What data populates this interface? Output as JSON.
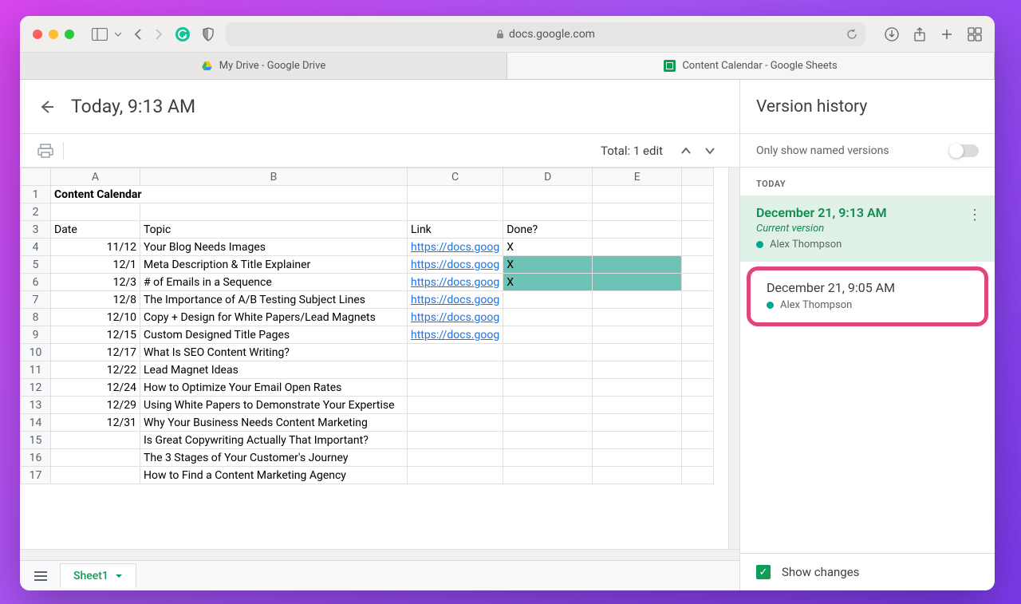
{
  "browser": {
    "url": "docs.google.com",
    "tabs": [
      {
        "label": "My Drive - Google Drive"
      },
      {
        "label": "Content Calendar - Google Sheets"
      }
    ]
  },
  "header": {
    "title": "Today, 9:13 AM"
  },
  "subtoolbar": {
    "edit_count": "Total: 1 edit"
  },
  "sheet": {
    "columns": [
      "A",
      "B",
      "C",
      "D",
      "E"
    ],
    "title": "Content Calendar",
    "headers": {
      "date": "Date",
      "topic": "Topic",
      "link": "Link",
      "done": "Done?"
    },
    "rows": [
      {
        "n": 4,
        "date": "11/12",
        "topic": "Your Blog Needs Images",
        "link": "https://docs.goog",
        "done": "X",
        "hlD": false,
        "hlE": false
      },
      {
        "n": 5,
        "date": "12/1",
        "topic": "Meta Description & Title Explainer",
        "link": "https://docs.goog",
        "done": "X",
        "hlD": true,
        "hlE": true
      },
      {
        "n": 6,
        "date": "12/3",
        "topic": "# of Emails in a Sequence",
        "link": "https://docs.goog",
        "done": "X",
        "hlD": true,
        "hlE": true
      },
      {
        "n": 7,
        "date": "12/8",
        "topic": "The Importance of A/B Testing Subject Lines",
        "link": "https://docs.goog",
        "done": "",
        "hlD": false,
        "hlE": false
      },
      {
        "n": 8,
        "date": "12/10",
        "topic": "Copy + Design for White Papers/Lead Magnets",
        "link": "https://docs.goog",
        "done": "",
        "hlD": false,
        "hlE": false
      },
      {
        "n": 9,
        "date": "12/15",
        "topic": "Custom Designed Title Pages",
        "link": "https://docs.goog",
        "done": "",
        "hlD": false,
        "hlE": false
      },
      {
        "n": 10,
        "date": "12/17",
        "topic": "What Is SEO Content Writing?",
        "link": "",
        "done": "",
        "hlD": false,
        "hlE": false
      },
      {
        "n": 11,
        "date": "12/22",
        "topic": "Lead Magnet Ideas",
        "link": "",
        "done": "",
        "hlD": false,
        "hlE": false
      },
      {
        "n": 12,
        "date": "12/24",
        "topic": "How to Optimize Your Email Open Rates",
        "link": "",
        "done": "",
        "hlD": false,
        "hlE": false
      },
      {
        "n": 13,
        "date": "12/29",
        "topic": "Using White Papers to Demonstrate Your Expertise",
        "link": "",
        "done": "",
        "hlD": false,
        "hlE": false
      },
      {
        "n": 14,
        "date": "12/31",
        "topic": "Why Your Business Needs Content Marketing",
        "link": "",
        "done": "",
        "hlD": false,
        "hlE": false
      },
      {
        "n": 15,
        "date": "",
        "topic": "Is Great Copywriting Actually That Important?",
        "link": "",
        "done": "",
        "hlD": false,
        "hlE": false
      },
      {
        "n": 16,
        "date": "",
        "topic": "The 3 Stages of Your Customer's Journey",
        "link": "",
        "done": "",
        "hlD": false,
        "hlE": false
      },
      {
        "n": 17,
        "date": "",
        "topic": "How to Find a Content Marketing Agency",
        "link": "",
        "done": "",
        "hlD": false,
        "hlE": false
      }
    ],
    "tab_name": "Sheet1"
  },
  "sidebar": {
    "title": "Version history",
    "only_named": "Only show named versions",
    "section": "TODAY",
    "versions": [
      {
        "time": "December 21, 9:13 AM",
        "label": "Current version",
        "author": "Alex Thompson",
        "current": true
      },
      {
        "time": "December 21, 9:05 AM",
        "label": "",
        "author": "Alex Thompson",
        "current": false
      }
    ],
    "show_changes": "Show changes"
  }
}
